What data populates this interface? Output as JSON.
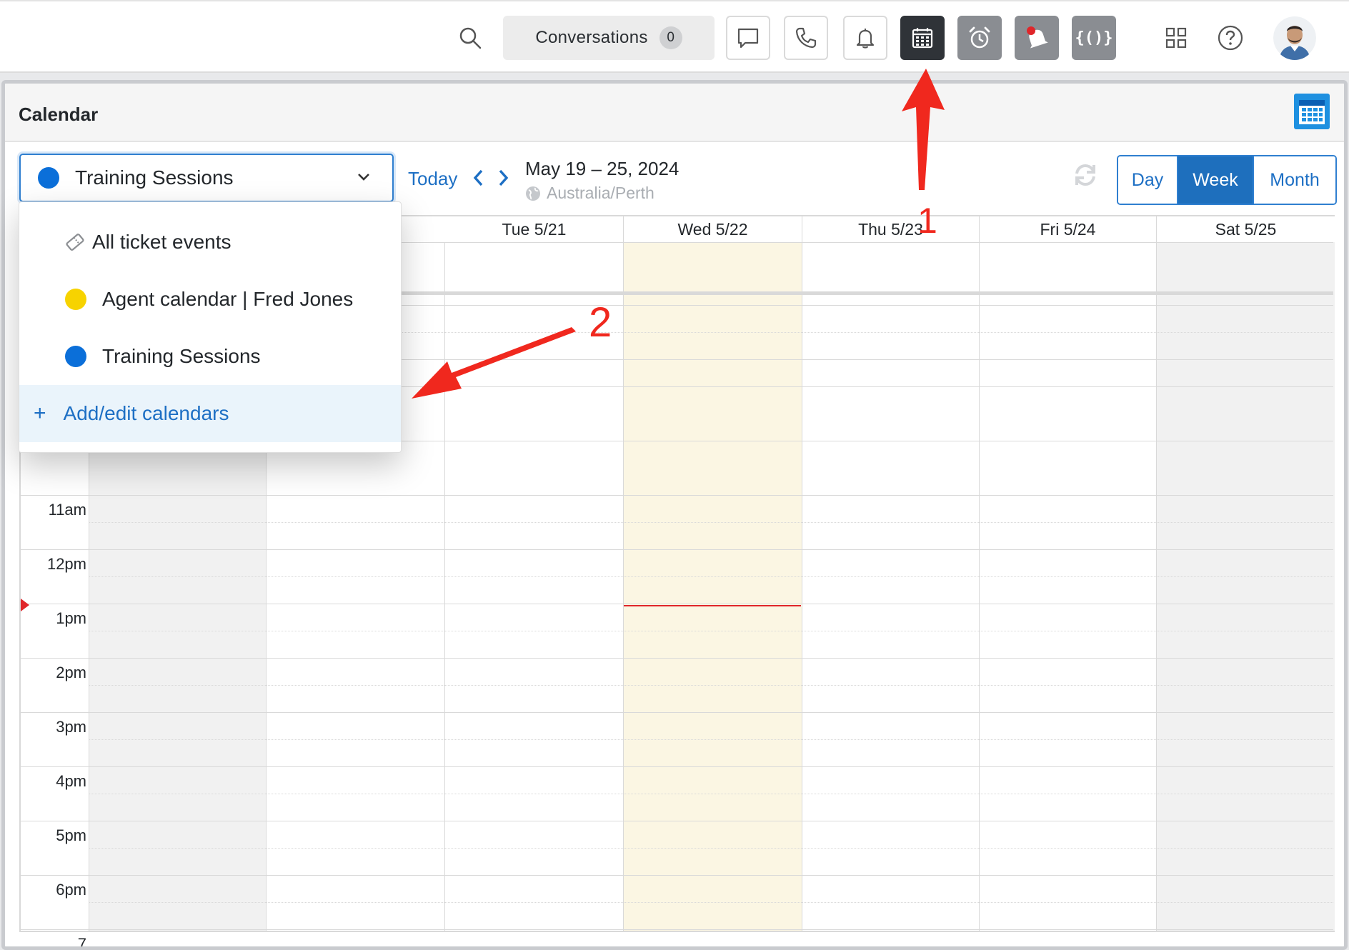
{
  "topbar": {
    "conversations_label": "Conversations",
    "conversations_count": "0",
    "icons": [
      "search-icon",
      "chat-icon",
      "phone-icon",
      "bell-icon",
      "calendar-icon",
      "alarm-clock-icon",
      "notification-bell-icon",
      "code-braces-icon",
      "apps-grid-icon",
      "help-icon",
      "avatar"
    ]
  },
  "panel": {
    "title": "Calendar"
  },
  "toolbar": {
    "selected_calendar": "Training Sessions",
    "today_label": "Today",
    "range": "May 19 – 25, 2024",
    "timezone": "Australia/Perth",
    "views": {
      "day": "Day",
      "week": "Week",
      "month": "Month",
      "active": "Week"
    }
  },
  "grid": {
    "columns": [
      "Tue 5/21",
      "Wed 5/22",
      "Thu 5/23",
      "Fri 5/24",
      "Sat 5/25"
    ],
    "hours": [
      "11am",
      "12pm",
      "1pm",
      "2pm",
      "3pm",
      "4pm",
      "5pm",
      "6pm",
      "7"
    ]
  },
  "dropdown": {
    "items": [
      {
        "label": "All ticket events",
        "icon": "ticket-icon"
      },
      {
        "label": "Agent calendar | Fred Jones",
        "color": "#f7d300"
      },
      {
        "label": "Training Sessions",
        "color": "#0b6fd9"
      }
    ],
    "add_label": "Add/edit calendars"
  },
  "annotations": {
    "step1": "1",
    "step2": "2",
    "color": "#f0281e"
  }
}
